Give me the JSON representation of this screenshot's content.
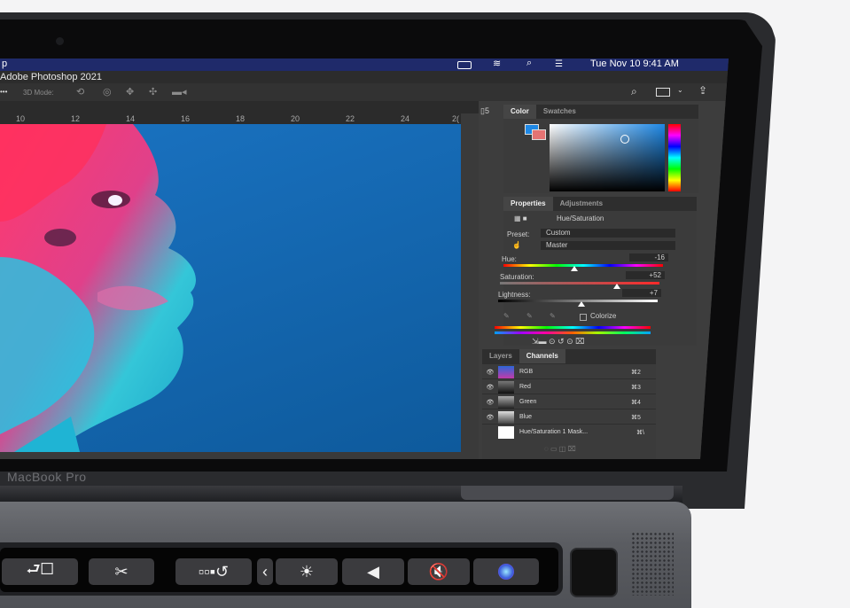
{
  "menubar": {
    "app_fragment": "p",
    "datetime": "Tue Nov 10  9:41 AM"
  },
  "window": {
    "title": "Adobe Photoshop 2021",
    "options_label": "3D Mode:"
  },
  "ruler": {
    "ticks": [
      "10",
      "12",
      "14",
      "16",
      "18",
      "20",
      "22",
      "24",
      "2("
    ]
  },
  "color_panel": {
    "tabs": [
      "Color",
      "Swatches"
    ],
    "active_tab": "Color",
    "foreground": "#1e88e5",
    "background": "#e57373"
  },
  "properties_panel": {
    "tabs": [
      "Properties",
      "Adjustments"
    ],
    "active_tab": "Properties",
    "adjustment_name": "Hue/Saturation",
    "preset_label": "Preset:",
    "preset_value": "Custom",
    "channel_value": "Master",
    "hue_label": "Hue:",
    "hue_value": "-16",
    "saturation_label": "Saturation:",
    "saturation_value": "+52",
    "lightness_label": "Lightness:",
    "lightness_value": "+7",
    "colorize_label": "Colorize"
  },
  "layers_panel": {
    "tabs": [
      "Layers",
      "Channels"
    ],
    "active_tab": "Channels",
    "channels": [
      {
        "name": "RGB",
        "shortcut": "⌘2"
      },
      {
        "name": "Red",
        "shortcut": "⌘3"
      },
      {
        "name": "Green",
        "shortcut": "⌘4"
      },
      {
        "name": "Blue",
        "shortcut": "⌘5"
      },
      {
        "name": "Hue/Saturation 1 Mask...",
        "shortcut": "⌘\\"
      }
    ]
  },
  "device": {
    "label": "MacBook Pro"
  },
  "touchbar": {
    "keys": [
      "screen-mirror-icon",
      "screenshot-icon",
      "window-restore-icon",
      "chevron-left-icon",
      "brightness-icon",
      "volume-icon",
      "mute-icon",
      "siri-icon"
    ]
  }
}
